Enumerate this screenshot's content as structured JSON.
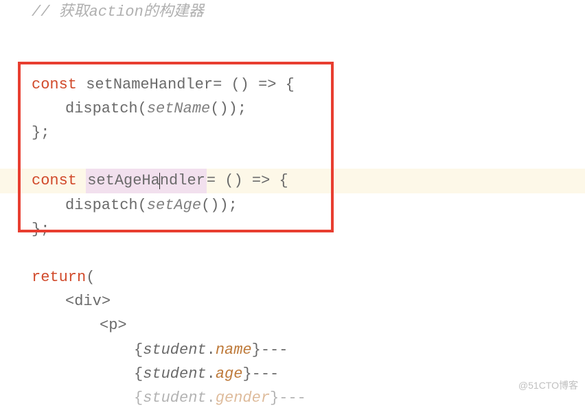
{
  "comment": "// 获取action的构建器",
  "line1": {
    "const": "const",
    "name": "setNameHandler",
    "arrow": " = () => {"
  },
  "line2": {
    "dispatch": "dispatch",
    "open": "(",
    "func": "setName",
    "close": "());"
  },
  "line3": "};",
  "line4": {
    "const": "const",
    "name": "setAgeHandler",
    "arrow": " = () => {"
  },
  "line5": {
    "dispatch": "dispatch",
    "open": "(",
    "func": "setAge",
    "close": "());"
  },
  "line6": "};",
  "return": {
    "keyword": "return",
    "paren": " ("
  },
  "jsx": {
    "divOpen": "<div>",
    "pOpen": "<p>",
    "student": "student",
    "name": "name",
    "age": "age",
    "gender": "gender",
    "dash": " ---",
    "dot": ".",
    "lbrace": "{",
    "rbrace": "}"
  },
  "watermark": "@51CTO博客"
}
